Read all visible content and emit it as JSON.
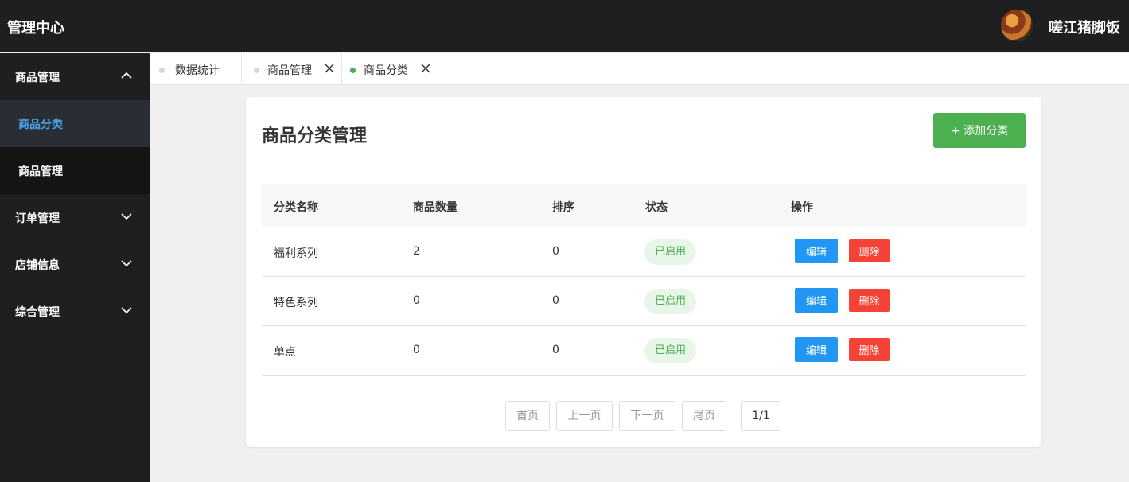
{
  "header": {
    "title": "管理中心",
    "shop_name": "嗟江猪脚饭"
  },
  "sidebar": {
    "items": [
      {
        "label": "商品管理",
        "expanded": true,
        "children": [
          {
            "label": "商品分类",
            "active": true
          },
          {
            "label": "商品管理",
            "active": false
          }
        ]
      },
      {
        "label": "订单管理",
        "expanded": false
      },
      {
        "label": "店铺信息",
        "expanded": false
      },
      {
        "label": "综合管理",
        "expanded": false
      }
    ]
  },
  "tabs": [
    {
      "label": "数据统计",
      "active": false,
      "closable": false
    },
    {
      "label": "商品管理",
      "active": false,
      "closable": true
    },
    {
      "label": "商品分类",
      "active": true,
      "closable": true
    }
  ],
  "main": {
    "title": "商品分类管理",
    "add_button": "+ 添加分类",
    "table": {
      "headers": [
        "分类名称",
        "商品数量",
        "排序",
        "状态",
        "操作"
      ],
      "rows": [
        {
          "name": "福利系列",
          "count": "2",
          "sort": "0",
          "status": "已启用",
          "edit": "编辑",
          "delete": "删除"
        },
        {
          "name": "特色系列",
          "count": "0",
          "sort": "0",
          "status": "已启用",
          "edit": "编辑",
          "delete": "删除"
        },
        {
          "name": "单点",
          "count": "0",
          "sort": "0",
          "status": "已启用",
          "edit": "编辑",
          "delete": "删除"
        }
      ]
    },
    "pagination": {
      "first": "首页",
      "prev": "上一页",
      "next": "下一页",
      "last": "尾页",
      "info": "1/1"
    }
  },
  "colors": {
    "topbar": "#1f1f21",
    "sidebar_active_text": "#4aa3e8",
    "accent_green": "#4caf50",
    "edit_blue": "#2196f3",
    "delete_red": "#f44336"
  },
  "icons": [
    "avatar-image",
    "chevron-up-icon",
    "chevron-down-icon",
    "close-icon",
    "dot-icon"
  ]
}
